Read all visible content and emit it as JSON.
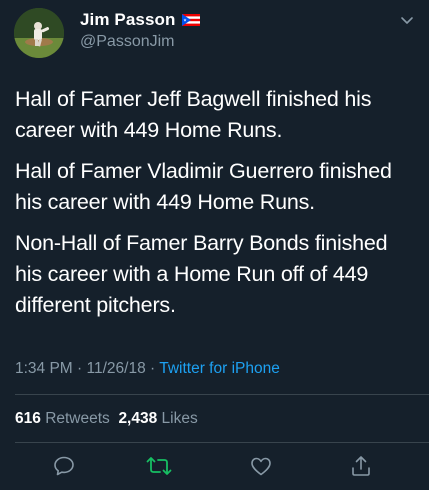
{
  "user": {
    "display_name": "Jim Passon",
    "handle": "@PassonJim",
    "flag_icon": "puerto-rico-flag-icon"
  },
  "tweet": {
    "paragraphs": [
      "Hall of Famer Jeff Bagwell finished his career with 449 Home Runs.",
      "Hall of Famer Vladimir Guerrero finished his career with 449 Home Runs.",
      "Non-Hall of Famer Barry Bonds finished his career with a Home Run off of 449 different pitchers."
    ],
    "time": "1:34 PM",
    "date": "11/26/18",
    "separator": "·",
    "source": "Twitter for iPhone"
  },
  "stats": {
    "retweets_count": "616",
    "retweets_label": "Retweets",
    "likes_count": "2,438",
    "likes_label": "Likes"
  },
  "actions": [
    "reply-icon",
    "retweet-icon",
    "like-icon",
    "share-icon"
  ],
  "colors": {
    "background": "#15202b",
    "secondary_text": "#8899a6",
    "link": "#1da1f2",
    "retweet_green": "#17bf63",
    "divider": "#38444d"
  }
}
